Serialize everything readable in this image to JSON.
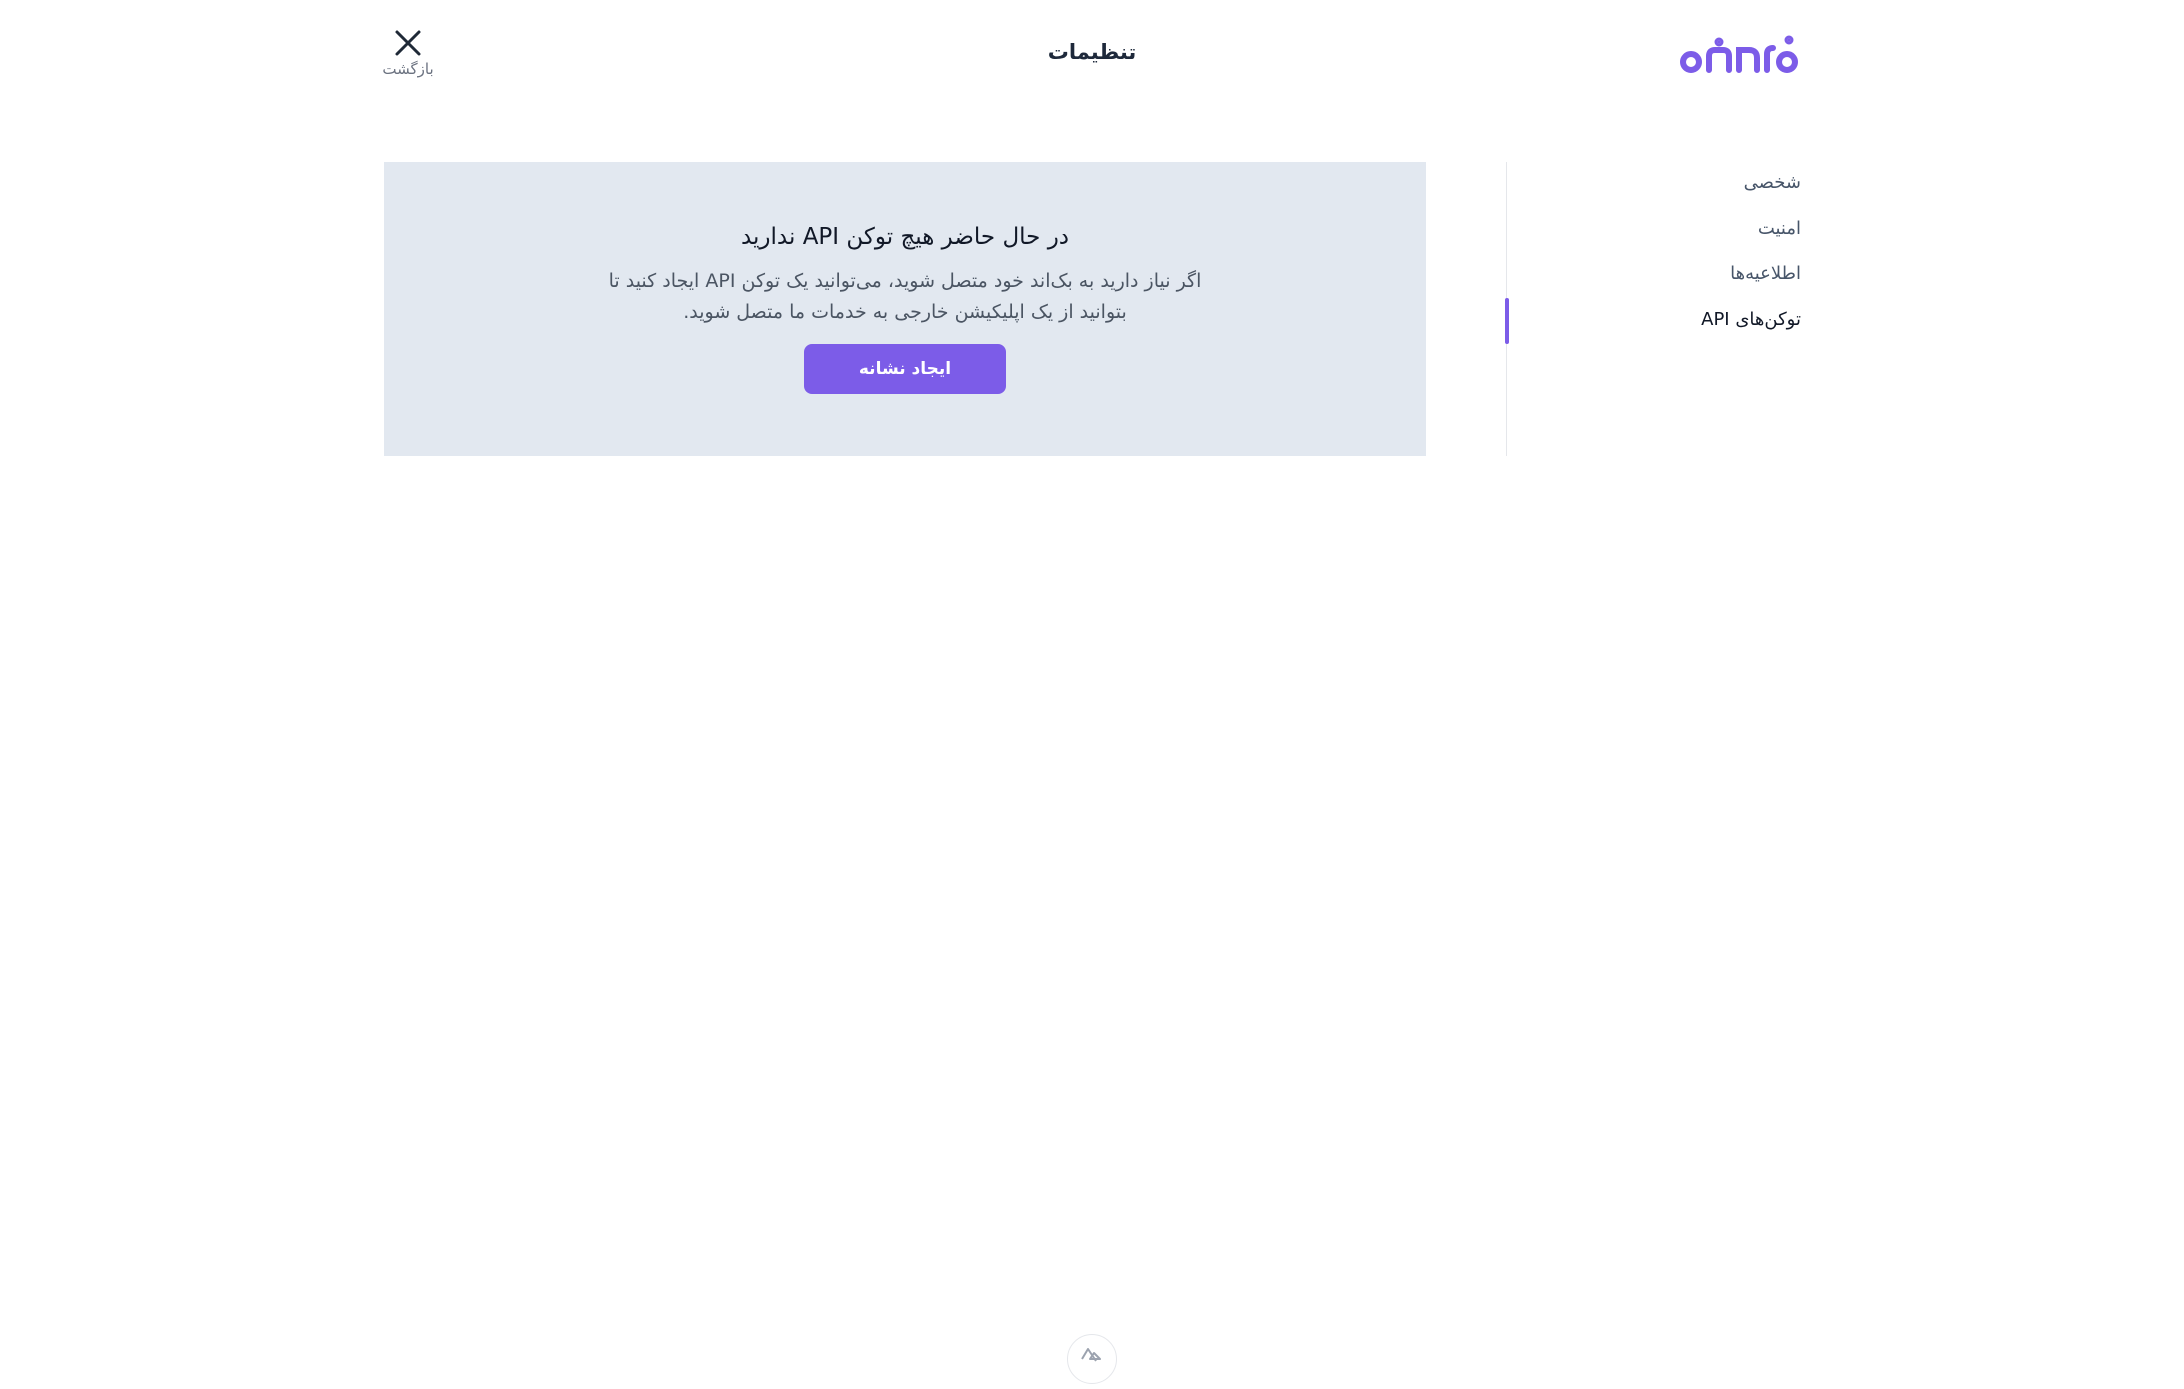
{
  "header": {
    "logo_text": "اتابرو",
    "title": "تنظیمات",
    "back_label": "بازگشت"
  },
  "sidebar": {
    "items": [
      {
        "label": "شخصی",
        "active": false
      },
      {
        "label": "امنیت",
        "active": false
      },
      {
        "label": "اطلاعیه‌ها",
        "active": false
      },
      {
        "label": "توکن‌های API",
        "active": true
      }
    ]
  },
  "main": {
    "empty_title": "در حال حاضر هیچ توکن API ندارید",
    "empty_description": "اگر نیاز دارید به بک‌اند خود متصل شوید، می‌توانید یک توکن API ایجاد کنید تا بتوانید از یک اپلیکیشن خارجی به خدمات ما متصل شوید.",
    "create_button": "ایجاد نشانه"
  },
  "colors": {
    "accent": "#7c5ce8",
    "card_bg": "#e2e8f0"
  },
  "icons": {
    "close": "close-icon",
    "footer": "nuxt-icon"
  }
}
